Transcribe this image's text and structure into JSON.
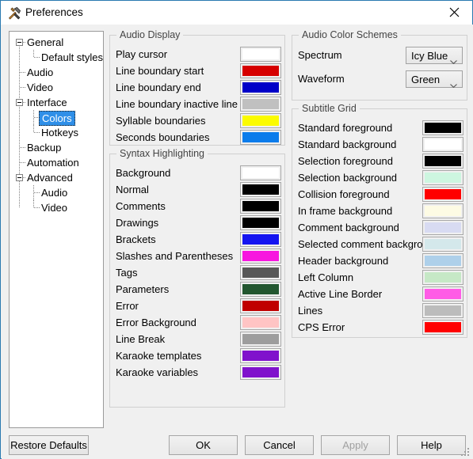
{
  "window": {
    "title": "Preferences",
    "icon": "tools-icon",
    "close_icon": "close-icon",
    "accent_border": "#2a7ab0"
  },
  "sidebar": {
    "name": "preferences-category-tree",
    "items": [
      {
        "label": "General",
        "level": 0,
        "expandable": true,
        "selected": false
      },
      {
        "label": "Default styles",
        "level": 1,
        "expandable": false,
        "selected": false
      },
      {
        "label": "Audio",
        "level": 0,
        "expandable": false,
        "selected": false
      },
      {
        "label": "Video",
        "level": 0,
        "expandable": false,
        "selected": false
      },
      {
        "label": "Interface",
        "level": 0,
        "expandable": true,
        "selected": false
      },
      {
        "label": "Colors",
        "level": 1,
        "expandable": false,
        "selected": true
      },
      {
        "label": "Hotkeys",
        "level": 1,
        "expandable": false,
        "selected": false
      },
      {
        "label": "Backup",
        "level": 0,
        "expandable": false,
        "selected": false
      },
      {
        "label": "Automation",
        "level": 0,
        "expandable": false,
        "selected": false
      },
      {
        "label": "Advanced",
        "level": 0,
        "expandable": true,
        "selected": false
      },
      {
        "label": "Audio",
        "level": 1,
        "expandable": false,
        "selected": false
      },
      {
        "label": "Video",
        "level": 1,
        "expandable": false,
        "selected": false
      }
    ],
    "selection_color": "#2f8fe8"
  },
  "groups": {
    "audio_display": {
      "title": "Audio Display",
      "rows": [
        {
          "label": "Play cursor",
          "color": "#ffffff"
        },
        {
          "label": "Line boundary start",
          "color": "#d60000"
        },
        {
          "label": "Line boundary end",
          "color": "#0000c8"
        },
        {
          "label": "Line boundary inactive line",
          "color": "#c0c0c0"
        },
        {
          "label": "Syllable boundaries",
          "color": "#fbfb00"
        },
        {
          "label": "Seconds boundaries",
          "color": "#0b7ceb"
        }
      ]
    },
    "syntax_highlighting": {
      "title": "Syntax Highlighting",
      "rows": [
        {
          "label": "Background",
          "color": "#ffffff"
        },
        {
          "label": "Normal",
          "color": "#000000"
        },
        {
          "label": "Comments",
          "color": "#000000"
        },
        {
          "label": "Drawings",
          "color": "#000000"
        },
        {
          "label": "Brackets",
          "color": "#1414f0"
        },
        {
          "label": "Slashes and Parentheses",
          "color": "#f716df"
        },
        {
          "label": "Tags",
          "color": "#585858"
        },
        {
          "label": "Parameters",
          "color": "#22562f"
        },
        {
          "label": "Error",
          "color": "#c00000"
        },
        {
          "label": "Error Background",
          "color": "#ffc4c4"
        },
        {
          "label": "Line Break",
          "color": "#9d9d9d"
        },
        {
          "label": "Karaoke templates",
          "color": "#8012cc"
        },
        {
          "label": "Karaoke variables",
          "color": "#8012cc"
        }
      ]
    },
    "audio_color_schemes": {
      "title": "Audio Color Schemes",
      "rows": [
        {
          "label": "Spectrum",
          "value": "Icy Blue"
        },
        {
          "label": "Waveform",
          "value": "Green"
        }
      ]
    },
    "subtitle_grid": {
      "title": "Subtitle Grid",
      "rows": [
        {
          "label": "Standard foreground",
          "color": "#000000"
        },
        {
          "label": "Standard background",
          "color": "#ffffff"
        },
        {
          "label": "Selection foreground",
          "color": "#000000"
        },
        {
          "label": "Selection background",
          "color": "#cdf6e0"
        },
        {
          "label": "Collision foreground",
          "color": "#ff0000"
        },
        {
          "label": "In frame background",
          "color": "#fdfbe4"
        },
        {
          "label": "Comment background",
          "color": "#d8dbf2"
        },
        {
          "label": "Selected comment background",
          "color": "#d4e8eb"
        },
        {
          "label": "Header background",
          "color": "#aed0ea"
        },
        {
          "label": "Left Column",
          "color": "#c6e8c6"
        },
        {
          "label": "Active Line Border",
          "color": "#ff5ce6"
        },
        {
          "label": "Lines",
          "color": "#bcbcbc"
        },
        {
          "label": "CPS Error",
          "color": "#ff0000"
        }
      ]
    }
  },
  "footer": {
    "restore_defaults": "Restore Defaults",
    "ok": "OK",
    "cancel": "Cancel",
    "apply": "Apply",
    "apply_disabled": true,
    "help": "Help"
  }
}
